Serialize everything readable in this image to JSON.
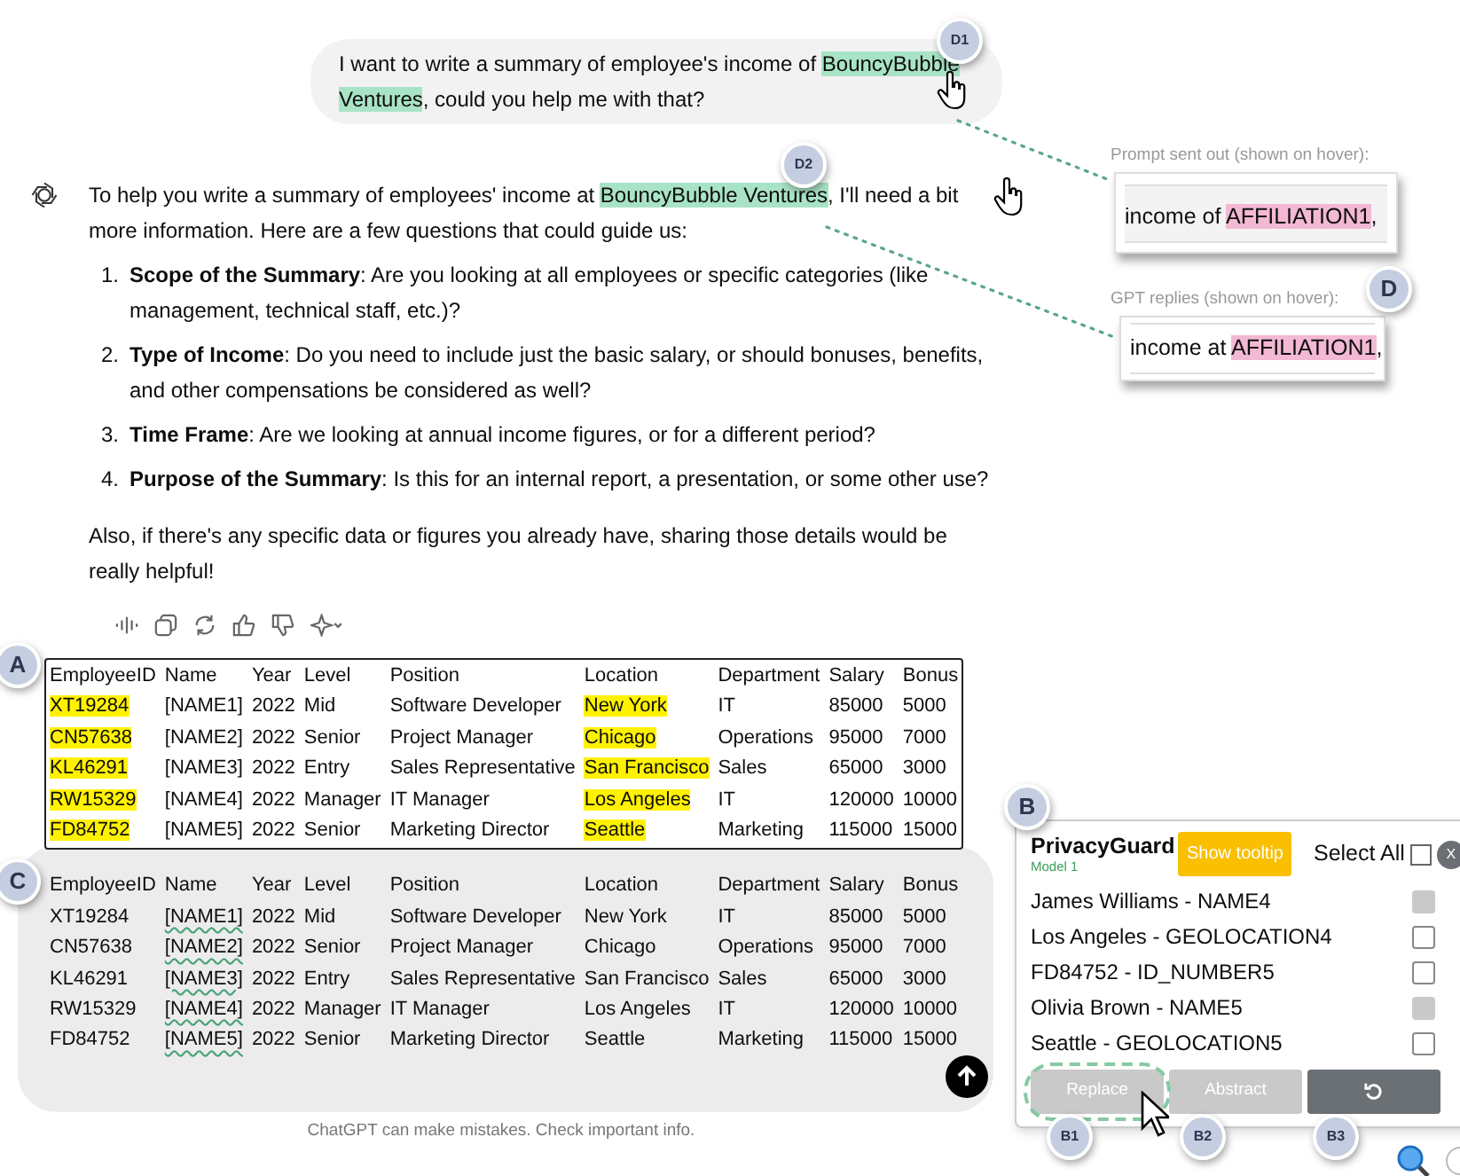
{
  "user_message": {
    "badge": "D1",
    "segments": [
      {
        "text": "I want to write a summary of employee's income of ",
        "highlighted": false
      },
      {
        "text": "BouncyBubble Ventures",
        "highlighted": true
      },
      {
        "text": ", could you help me with that?",
        "highlighted": false
      }
    ]
  },
  "assistant_message": {
    "badge": "D2",
    "intro": [
      {
        "text": "To help you write a summary of employees' income at ",
        "highlighted": false
      },
      {
        "text": "BouncyBubble Ventures",
        "highlighted": true
      },
      {
        "text": ", I'll need a bit more information. Here are a few questions that could guide us:",
        "highlighted": false
      }
    ],
    "questions": [
      {
        "number": "1.",
        "text": "**Scope of the Summary**: Are you looking at all employees or specific categories (like management, technical staff, etc.)?"
      },
      {
        "number": "2.",
        "text": "**Type of Income**: Do you need to include just the basic salary, or should bonuses, benefits, and other compensations be considered as well?"
      },
      {
        "number": "3.",
        "text": "**Time Frame**: Are we looking at annual income figures, or for a different period?"
      },
      {
        "number": "4.",
        "text": "**Purpose of the Summary**: Is this for an internal report, a presentation, or some other use?"
      }
    ],
    "closing": "Also, if there's any specific data or figures you already have, sharing those details would be really helpful!"
  },
  "original_table": {
    "badge": "A",
    "rows": [
      [
        {
          "text": "EmployeeID",
          "highlighted": false
        },
        {
          "text": "Name",
          "highlighted": false
        },
        {
          "text": "Year",
          "highlighted": false
        },
        {
          "text": "Level",
          "highlighted": false
        },
        {
          "text": "Position",
          "highlighted": false
        },
        {
          "text": "Location",
          "highlighted": false
        },
        {
          "text": "Department",
          "highlighted": false
        },
        {
          "text": "Salary",
          "highlighted": false
        },
        {
          "text": "Bonus",
          "highlighted": false
        }
      ],
      [
        {
          "text": "XT19284",
          "highlighted": true
        },
        {
          "text": "[NAME1]",
          "highlighted": false
        },
        {
          "text": "2022",
          "highlighted": false
        },
        {
          "text": "Mid",
          "highlighted": false
        },
        {
          "text": "Software Developer",
          "highlighted": false
        },
        {
          "text": "New York",
          "highlighted": true
        },
        {
          "text": "IT",
          "highlighted": false
        },
        {
          "text": "85000",
          "highlighted": false
        },
        {
          "text": "5000",
          "highlighted": false
        }
      ],
      [
        {
          "text": "CN57638",
          "highlighted": true
        },
        {
          "text": "[NAME2]",
          "highlighted": false
        },
        {
          "text": "2022",
          "highlighted": false
        },
        {
          "text": "Senior",
          "highlighted": false
        },
        {
          "text": "Project Manager",
          "highlighted": false
        },
        {
          "text": "Chicago",
          "highlighted": true
        },
        {
          "text": "Operations",
          "highlighted": false
        },
        {
          "text": "95000",
          "highlighted": false
        },
        {
          "text": "7000",
          "highlighted": false
        }
      ],
      [
        {
          "text": "KL46291",
          "highlighted": true
        },
        {
          "text": "[NAME3]",
          "highlighted": false
        },
        {
          "text": "2022",
          "highlighted": false
        },
        {
          "text": "Entry",
          "highlighted": false
        },
        {
          "text": "Sales Representative",
          "highlighted": false
        },
        {
          "text": "San Francisco",
          "highlighted": true
        },
        {
          "text": "Sales",
          "highlighted": false
        },
        {
          "text": "65000",
          "highlighted": false
        },
        {
          "text": "3000",
          "highlighted": false
        }
      ],
      [
        {
          "text": "RW15329",
          "highlighted": true
        },
        {
          "text": "[NAME4]",
          "highlighted": false
        },
        {
          "text": "2022",
          "highlighted": false
        },
        {
          "text": "Manager",
          "highlighted": false
        },
        {
          "text": "IT Manager",
          "highlighted": false
        },
        {
          "text": "Los Angeles",
          "highlighted": true
        },
        {
          "text": "IT",
          "highlighted": false
        },
        {
          "text": "120000",
          "highlighted": false
        },
        {
          "text": "10000",
          "highlighted": false
        }
      ],
      [
        {
          "text": "FD84752",
          "highlighted": true
        },
        {
          "text": "[NAME5]",
          "highlighted": false
        },
        {
          "text": "2022",
          "highlighted": false
        },
        {
          "text": "Senior",
          "highlighted": false
        },
        {
          "text": "Marketing Director",
          "highlighted": false
        },
        {
          "text": "Seattle",
          "highlighted": true
        },
        {
          "text": "Marketing",
          "highlighted": false
        },
        {
          "text": "115000",
          "highlighted": false
        },
        {
          "text": "15000",
          "highlighted": false
        }
      ]
    ]
  },
  "prompt_input": {
    "badge": "C",
    "rows": [
      [
        {
          "text": "EmployeeID",
          "flagged": false
        },
        {
          "text": "Name",
          "flagged": false
        },
        {
          "text": "Year",
          "flagged": false
        },
        {
          "text": "Level",
          "flagged": false
        },
        {
          "text": "Position",
          "flagged": false
        },
        {
          "text": "Location",
          "flagged": false
        },
        {
          "text": "Department",
          "flagged": false
        },
        {
          "text": "Salary",
          "flagged": false
        },
        {
          "text": "Bonus",
          "flagged": false
        }
      ],
      [
        {
          "text": "XT19284",
          "flagged": false
        },
        {
          "text": "[NAME1]",
          "flagged": true
        },
        {
          "text": "2022",
          "flagged": false
        },
        {
          "text": "Mid",
          "flagged": false
        },
        {
          "text": "Software Developer",
          "flagged": false
        },
        {
          "text": "New York",
          "flagged": false
        },
        {
          "text": "IT",
          "flagged": false
        },
        {
          "text": "85000",
          "flagged": false
        },
        {
          "text": "5000",
          "flagged": false
        }
      ],
      [
        {
          "text": "CN57638",
          "flagged": false
        },
        {
          "text": "[NAME2]",
          "flagged": true
        },
        {
          "text": "2022",
          "flagged": false
        },
        {
          "text": "Senior",
          "flagged": false
        },
        {
          "text": "Project Manager",
          "flagged": false
        },
        {
          "text": "Chicago",
          "flagged": false
        },
        {
          "text": "Operations",
          "flagged": false
        },
        {
          "text": "95000",
          "flagged": false
        },
        {
          "text": "7000",
          "flagged": false
        }
      ],
      [
        {
          "text": "KL46291",
          "flagged": false
        },
        {
          "text": "[NAME3]",
          "flagged": true
        },
        {
          "text": "2022",
          "flagged": false
        },
        {
          "text": "Entry",
          "flagged": false
        },
        {
          "text": "Sales Representative",
          "flagged": false
        },
        {
          "text": "San Francisco",
          "flagged": false
        },
        {
          "text": "Sales",
          "flagged": false
        },
        {
          "text": "65000",
          "flagged": false
        },
        {
          "text": "3000",
          "flagged": false
        }
      ],
      [
        {
          "text": "RW15329",
          "flagged": false
        },
        {
          "text": "[NAME4]",
          "flagged": true
        },
        {
          "text": "2022",
          "flagged": false
        },
        {
          "text": "Manager",
          "flagged": false
        },
        {
          "text": "IT Manager",
          "flagged": false
        },
        {
          "text": "Los Angeles",
          "flagged": false
        },
        {
          "text": "IT",
          "flagged": false
        },
        {
          "text": "120000",
          "flagged": false
        },
        {
          "text": "10000",
          "flagged": false
        }
      ],
      [
        {
          "text": "FD84752",
          "flagged": false
        },
        {
          "text": "[NAME5]",
          "flagged": true
        },
        {
          "text": "2022",
          "flagged": false
        },
        {
          "text": "Senior",
          "flagged": false
        },
        {
          "text": "Marketing Director",
          "flagged": false
        },
        {
          "text": "Seattle",
          "flagged": false
        },
        {
          "text": "Marketing",
          "flagged": false
        },
        {
          "text": "115000",
          "flagged": false
        },
        {
          "text": "15000",
          "flagged": false
        }
      ]
    ]
  },
  "footer_note": "ChatGPT can make mistakes. Check important info.",
  "hover_previews": {
    "badge": "D",
    "items": [
      {
        "caption": "Prompt sent out (shown on hover):",
        "segments": [
          {
            "text": "income of ",
            "highlighted": false
          },
          {
            "text": "AFFILIATION1",
            "highlighted": true
          },
          {
            "text": ",",
            "highlighted": false
          }
        ]
      },
      {
        "caption": "GPT replies (shown on hover):",
        "segments": [
          {
            "text": "income at ",
            "highlighted": false
          },
          {
            "text": "AFFILIATION1",
            "highlighted": true
          },
          {
            "text": ",",
            "highlighted": false
          }
        ]
      }
    ]
  },
  "privacy_panel": {
    "badge": "B",
    "title": "PrivacyGuard",
    "subtitle": "Model 1",
    "tooltip_button": "Show tooltip",
    "select_all": {
      "label": "Select All",
      "checked": false
    },
    "close": "X",
    "entities": [
      {
        "label": "James Williams - NAME4",
        "checked": true
      },
      {
        "label": "Los Angeles - GEOLOCATION4",
        "checked": false
      },
      {
        "label": "FD84752 - ID_NUMBER5",
        "checked": false
      },
      {
        "label": "Olivia Brown - NAME5",
        "checked": true
      },
      {
        "label": "Seattle - GEOLOCATION5",
        "checked": false
      }
    ],
    "buttons": [
      {
        "kind": "text",
        "label": "Replace",
        "badge": "B1",
        "disabled": true
      },
      {
        "kind": "text",
        "label": "Abstract",
        "badge": "B2",
        "disabled": true
      },
      {
        "kind": "reset",
        "badge": "B3",
        "disabled": false
      }
    ]
  }
}
